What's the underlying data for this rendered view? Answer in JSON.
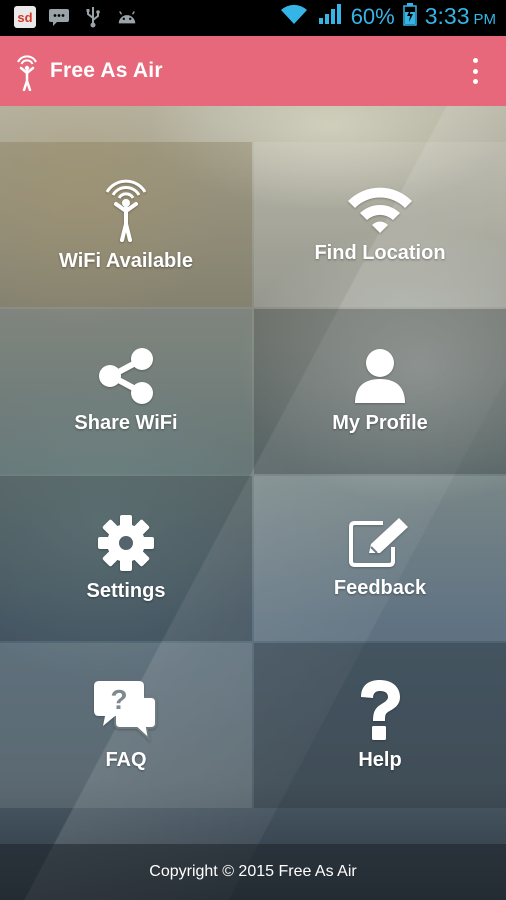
{
  "status_bar": {
    "left_icons": [
      "sd-app-icon",
      "message-icon",
      "usb-icon",
      "android-icon"
    ],
    "sd_label": "sd",
    "battery_percent": "60%",
    "time": "3:33",
    "ampm": "PM",
    "color": "#35b4e6"
  },
  "toolbar": {
    "title": "Free As Air",
    "background": "#e7687a",
    "menu_icon": "overflow-menu-icon"
  },
  "menu": {
    "tiles": [
      {
        "label": "WiFi Available",
        "icon": "wifi-person-icon"
      },
      {
        "label": "Find Location",
        "icon": "wifi-icon"
      },
      {
        "label": "Share WiFi",
        "icon": "share-icon"
      },
      {
        "label": "My Profile",
        "icon": "user-icon"
      },
      {
        "label": "Settings",
        "icon": "gear-icon"
      },
      {
        "label": "Feedback",
        "icon": "edit-icon"
      },
      {
        "label": "FAQ",
        "icon": "faq-chat-icon"
      },
      {
        "label": "Help",
        "icon": "question-icon"
      }
    ]
  },
  "footer": {
    "copyright": "Copyright © 2015 Free As Air"
  }
}
